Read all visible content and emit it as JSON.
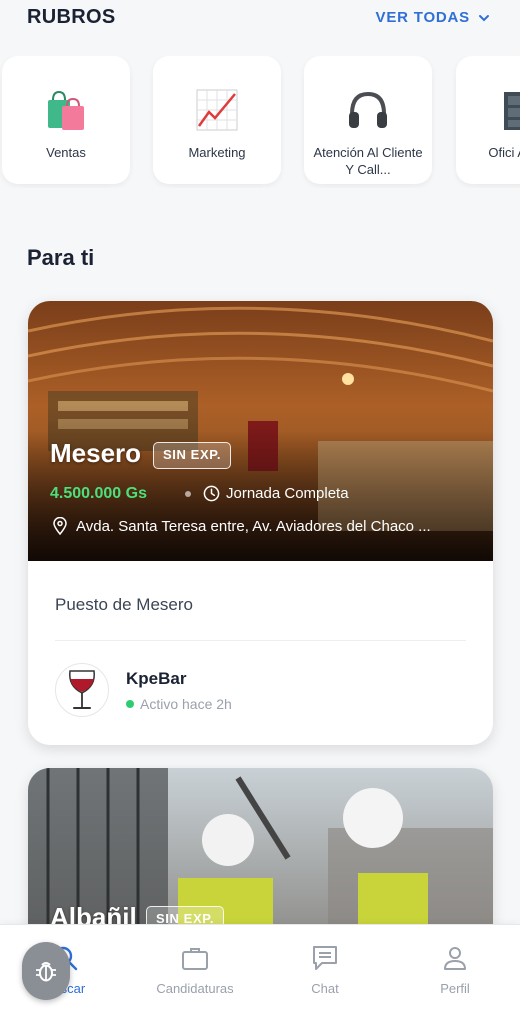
{
  "header": {
    "section_title": "RUBROS",
    "see_all_label": "VER TODAS"
  },
  "categories": [
    {
      "label": "Ventas",
      "icon": "shopping-bags-icon"
    },
    {
      "label": "Marketing",
      "icon": "chart-rising-icon"
    },
    {
      "label": "Atención Al Cliente Y Call...",
      "icon": "headphones-icon"
    },
    {
      "label": "Ofici Adminis",
      "icon": "filing-cabinet-icon"
    }
  ],
  "feed": {
    "title": "Para ti"
  },
  "jobs": [
    {
      "title": "Mesero",
      "experience_badge": "SIN EXP.",
      "salary": "4.500.000 Gs",
      "schedule": "Jornada Completa",
      "location": "Avda. Santa Teresa entre, Av. Aviadores del Chaco ...",
      "description": "Puesto de Mesero",
      "company": {
        "name": "KpeBar",
        "status": "Activo hace 2h"
      }
    },
    {
      "title": "Albañil",
      "experience_badge": "SIN EXP."
    }
  ],
  "bottom_nav": [
    {
      "label": "Buscar",
      "icon": "search-icon",
      "active": true
    },
    {
      "label": "Candidaturas",
      "icon": "briefcase-icon",
      "active": false
    },
    {
      "label": "Chat",
      "icon": "chat-icon",
      "active": false
    },
    {
      "label": "Perfil",
      "icon": "user-icon",
      "active": false
    }
  ],
  "colors": {
    "accent": "#2f6fd6",
    "salary": "#4ce07a",
    "online": "#2ecc71"
  }
}
